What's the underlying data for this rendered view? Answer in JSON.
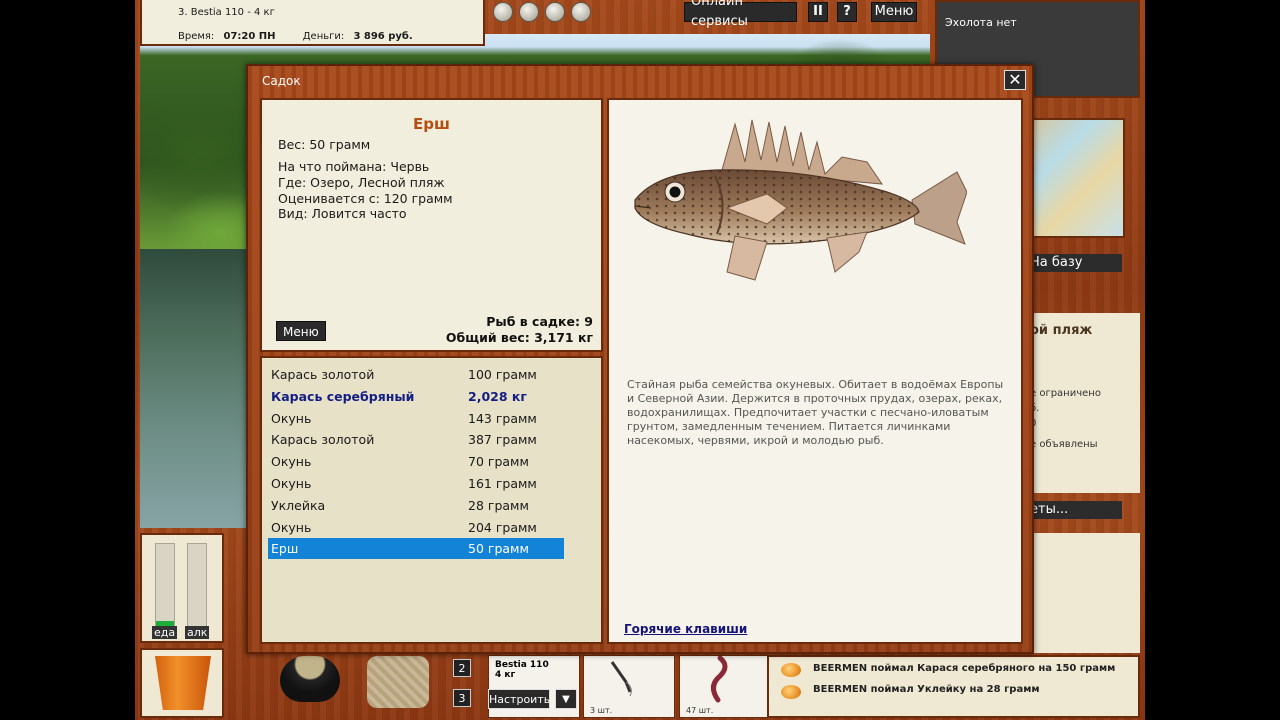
{
  "hud": {
    "rod_line": "3. Bestia 110 - 4 кг",
    "time_label": "Время:",
    "time_value": "07:20 ПН",
    "money_label": "Деньги:",
    "money_value": "3 896 руб.",
    "online_services": "Онлайн сервисы",
    "pause": "II",
    "help": "?",
    "menu": "Меню",
    "echo": "Эхолота нет",
    "to_base": "На базу",
    "location_partial": "ой пляж",
    "info_lines": [
      "е ограничено",
      "б.",
      "0",
      "е объявлены"
    ],
    "right_button": "еты...",
    "food_label": "еда",
    "alc_label": "алк",
    "food_level": 0.06,
    "alc_level": 0.0,
    "slot_2": "2",
    "slot_3": "3",
    "rod_slot_name": "Bestia 110",
    "rod_slot_weight": "4 кг",
    "configure": "Настроить",
    "bait1_count": "3 шт.",
    "bait2_count": "47 шт.",
    "log": [
      "BEERMEN поймал Карася серебряного на 150 грамм",
      "BEERMEN поймал Уклейку на 28 грамм"
    ]
  },
  "dialog": {
    "title": "Садок",
    "close": "✕",
    "fish_name": "Ерш",
    "weight_line": "Вес: 50 грамм",
    "caught_on": "На что поймана: Червь",
    "where": "Где: Озеро, Лесной пляж",
    "valued_from": "Оценивается с: 120 грамм",
    "kind": "Вид: Ловится часто",
    "menu_button": "Меню",
    "fish_count": "Рыб в садке: 9",
    "total_weight": "Общий вес: 3,171 кг",
    "catch_list": [
      {
        "name": "Карась золотой",
        "weight": "100 грамм",
        "style": "normal"
      },
      {
        "name": "Карась серебряный",
        "weight": "2,028 кг",
        "style": "bold"
      },
      {
        "name": "Окунь",
        "weight": "143 грамм",
        "style": "normal"
      },
      {
        "name": "Карась золотой",
        "weight": "387 грамм",
        "style": "normal"
      },
      {
        "name": "Окунь",
        "weight": "70 грамм",
        "style": "normal"
      },
      {
        "name": "Окунь",
        "weight": "161 грамм",
        "style": "normal"
      },
      {
        "name": "Уклейка",
        "weight": "28 грамм",
        "style": "normal"
      },
      {
        "name": "Окунь",
        "weight": "204 грамм",
        "style": "normal"
      },
      {
        "name": "Ерш",
        "weight": "50 грамм",
        "style": "selected"
      }
    ],
    "description": "Стайная рыба семейства окуневых. Обитает в водоёмах Европы и Северной Азии. Держится в проточных прудах, озерах, реках, водохранилищах. Предпочитает участки с песчано-иловатым грунтом, замедленным течением. Питается личинками насекомых, червями, икрой и молодью рыб.",
    "hotkeys": "Горячие клавиши"
  },
  "colors": {
    "wood": "#a54a1c",
    "panel": "#f1eedd",
    "fish_title": "#b64d12",
    "selection": "#1383d8",
    "bold_row": "#141e84"
  }
}
